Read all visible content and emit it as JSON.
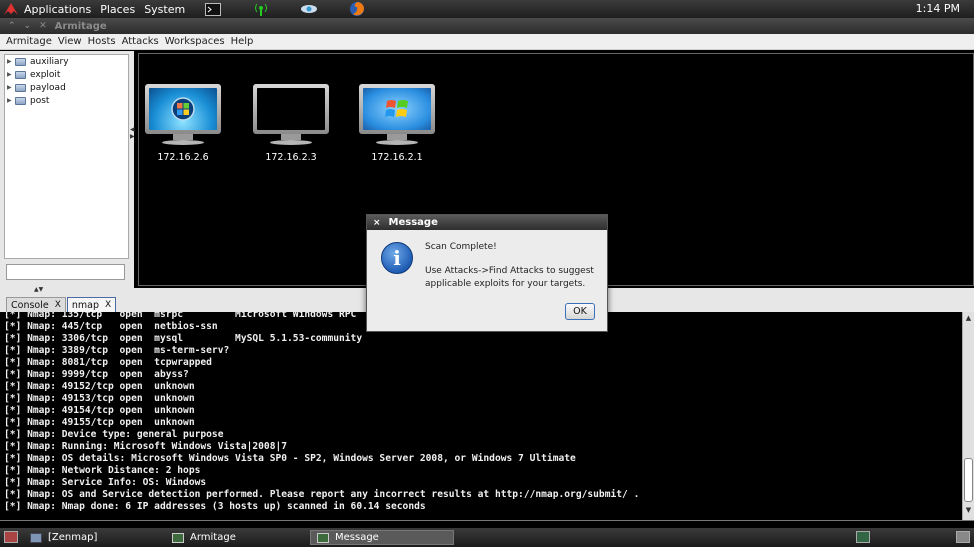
{
  "top_panel": {
    "menus": [
      "Applications",
      "Places",
      "System"
    ],
    "clock": "1:14 PM"
  },
  "window": {
    "title": "Armitage"
  },
  "menubar": [
    "Armitage",
    "View",
    "Hosts",
    "Attacks",
    "Workspaces",
    "Help"
  ],
  "module_tree": [
    "auxiliary",
    "exploit",
    "payload",
    "post"
  ],
  "hosts": [
    {
      "ip": "172.16.2.6",
      "os": "windows-vista-icon"
    },
    {
      "ip": "172.16.2.3",
      "os": "unknown-os-icon"
    },
    {
      "ip": "172.16.2.1",
      "os": "windows-xp-icon"
    }
  ],
  "tabs": [
    {
      "label": "Console",
      "close": "X",
      "active": false
    },
    {
      "label": "nmap",
      "close": "X",
      "active": true
    }
  ],
  "console_lines": [
    "[*] Nmap: 135/tcp   open  msrpc         Microsoft Windows RPC",
    "[*] Nmap: 445/tcp   open  netbios-ssn",
    "[*] Nmap: 3306/tcp  open  mysql         MySQL 5.1.53-community",
    "[*] Nmap: 3389/tcp  open  ms-term-serv?",
    "[*] Nmap: 8081/tcp  open  tcpwrapped",
    "[*] Nmap: 9999/tcp  open  abyss?",
    "[*] Nmap: 49152/tcp open  unknown",
    "[*] Nmap: 49153/tcp open  unknown",
    "[*] Nmap: 49154/tcp open  unknown",
    "[*] Nmap: 49155/tcp open  unknown",
    "[*] Nmap: Device type: general purpose",
    "[*] Nmap: Running: Microsoft Windows Vista|2008|7",
    "[*] Nmap: OS details: Microsoft Windows Vista SP0 - SP2, Windows Server 2008, or Windows 7 Ultimate",
    "[*] Nmap: Network Distance: 2 hops",
    "[*] Nmap: Service Info: OS: Windows",
    "[*] Nmap: OS and Service detection performed. Please report any incorrect results at http://nmap.org/submit/ .",
    "[*] Nmap: Nmap done: 6 IP addresses (3 hosts up) scanned in 60.14 seconds"
  ],
  "dialog": {
    "title": "Message",
    "close": "×",
    "line1": "Scan Complete!",
    "line2": "Use Attacks->Find Attacks to suggest applicable exploits for your targets.",
    "ok": "OK",
    "icon_glyph": "i"
  },
  "taskbar": {
    "items": [
      "[Zenmap]",
      "Armitage",
      "Message"
    ]
  }
}
